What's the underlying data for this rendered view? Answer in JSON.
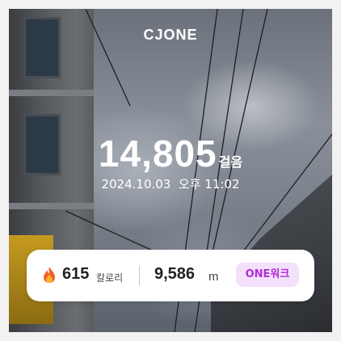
{
  "brand": {
    "logo_text": "CJONE"
  },
  "steps": {
    "value": "14,805",
    "unit": "걸음"
  },
  "timestamp": {
    "date": "2024.10.03",
    "time": "오후 11:02"
  },
  "stats": {
    "calories": {
      "value": "615",
      "unit": "칼로리",
      "icon": "fire-icon"
    },
    "distance": {
      "value": "9,586",
      "unit": "m"
    }
  },
  "badge": {
    "label": "ONE워크"
  },
  "colors": {
    "badge_bg": "#f3e0fb",
    "badge_text": "#b12bd8",
    "card_bg": "#ffffff",
    "overlay_text": "#ffffff"
  }
}
